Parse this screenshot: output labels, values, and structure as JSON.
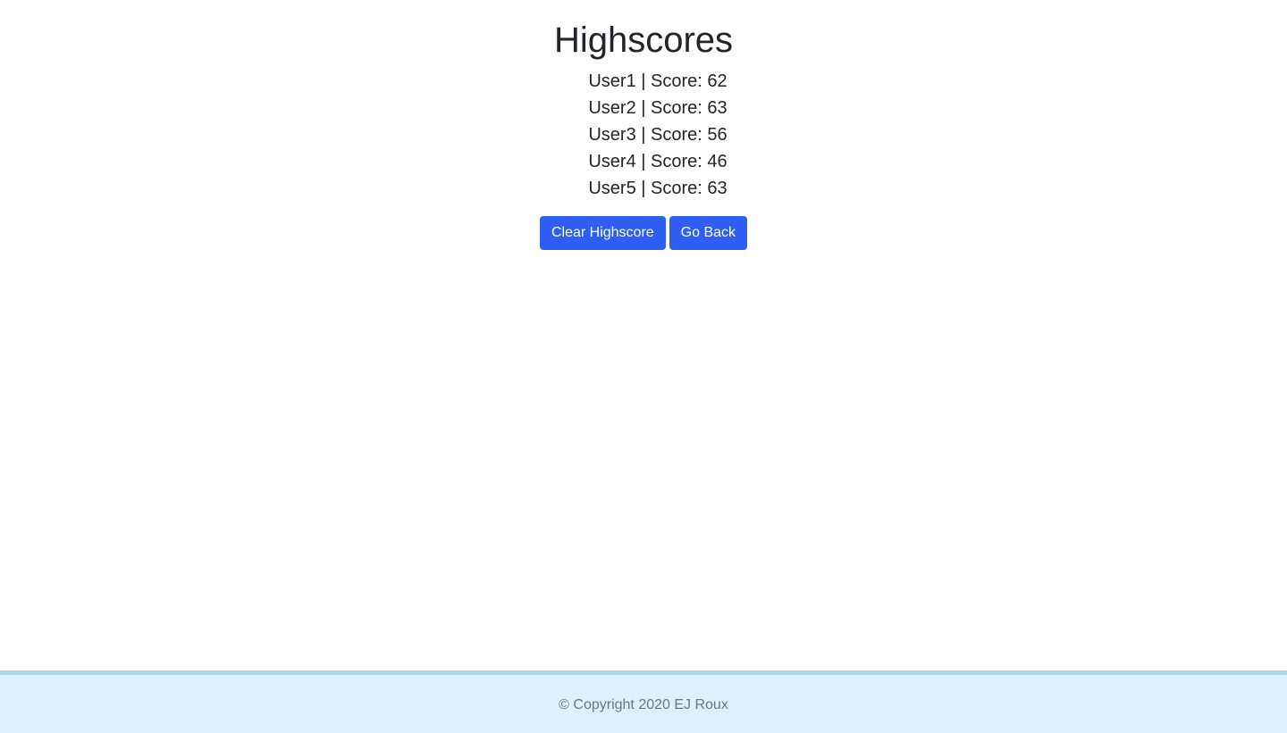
{
  "header": {
    "title": "Highscores"
  },
  "scores": [
    {
      "text": "User1 | Score: 62"
    },
    {
      "text": "User2 | Score: 63"
    },
    {
      "text": "User3 | Score: 56"
    },
    {
      "text": "User4 | Score: 46"
    },
    {
      "text": "User5 | Score: 63"
    }
  ],
  "actions": {
    "clear_label": "Clear Highscore",
    "back_label": "Go Back"
  },
  "footer": {
    "copyright": "© Copyright 2020 EJ Roux"
  },
  "colors": {
    "button": "#2f5ff2",
    "footer_bg": "#dff0fc",
    "footer_border": "#a6d8e6"
  }
}
